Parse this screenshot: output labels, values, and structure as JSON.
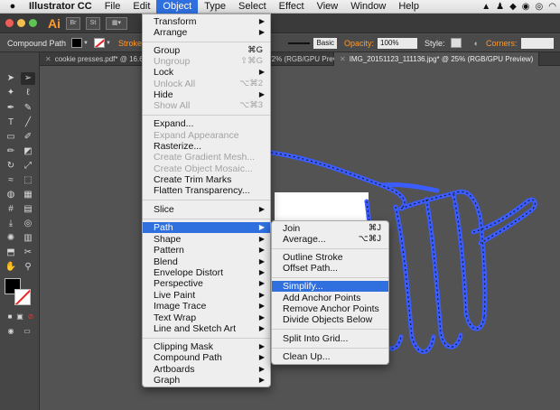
{
  "menubar": {
    "app_name": "Illustrator CC",
    "items": [
      "File",
      "Edit",
      "Object",
      "Type",
      "Select",
      "Effect",
      "View",
      "Window",
      "Help"
    ],
    "active_item": "Object"
  },
  "appbar": {
    "logo": "Ai",
    "btn_br": "Br",
    "btn_st": "St"
  },
  "controlbar": {
    "selection_type": "Compound Path",
    "stroke_label": "Stroke:",
    "brush": "Basic",
    "opacity_label": "Opacity:",
    "opacity_value": "100%",
    "style_label": "Style:",
    "corners_label": "Corners:"
  },
  "tabs": [
    {
      "label": "cookie presses.pdf* @ 16.67"
    },
    {
      "label": "coffee @ 72% (RGB/GPU Preview)"
    },
    {
      "label": "IMG_20151123_111136.jpg* @ 25% (RGB/GPU Preview)"
    }
  ],
  "object_menu": {
    "transform": "Transform",
    "arrange": "Arrange",
    "group": "Group",
    "group_sc": "⌘G",
    "ungroup": "Ungroup",
    "ungroup_sc": "⇧⌘G",
    "lock": "Lock",
    "unlock_all": "Unlock All",
    "unlock_all_sc": "⌥⌘2",
    "hide": "Hide",
    "show_all": "Show All",
    "show_all_sc": "⌥⌘3",
    "expand": "Expand...",
    "expand_appearance": "Expand Appearance",
    "rasterize": "Rasterize...",
    "create_gradient_mesh": "Create Gradient Mesh...",
    "create_object_mosaic": "Create Object Mosaic...",
    "create_trim_marks": "Create Trim Marks",
    "flatten_transparency": "Flatten Transparency...",
    "slice": "Slice",
    "path": "Path",
    "shape": "Shape",
    "pattern": "Pattern",
    "blend": "Blend",
    "envelope_distort": "Envelope Distort",
    "perspective": "Perspective",
    "live_paint": "Live Paint",
    "image_trace": "Image Trace",
    "text_wrap": "Text Wrap",
    "line_and_sketch_art": "Line and Sketch Art",
    "clipping_mask": "Clipping Mask",
    "compound_path": "Compound Path",
    "artboards": "Artboards",
    "graph": "Graph"
  },
  "path_submenu": {
    "join": "Join",
    "join_sc": "⌘J",
    "average": "Average...",
    "average_sc": "⌥⌘J",
    "outline_stroke": "Outline Stroke",
    "offset_path": "Offset Path...",
    "simplify": "Simplify...",
    "add_anchor_points": "Add Anchor Points",
    "remove_anchor_points": "Remove Anchor Points",
    "divide_objects_below": "Divide Objects Below",
    "split_into_grid": "Split Into Grid...",
    "clean_up": "Clean Up..."
  },
  "colors": {
    "highlight": "#2f6fde",
    "selection_path": "#3b5cff",
    "menu_bg": "#eeeeee",
    "canvas_bg": "#535353"
  }
}
